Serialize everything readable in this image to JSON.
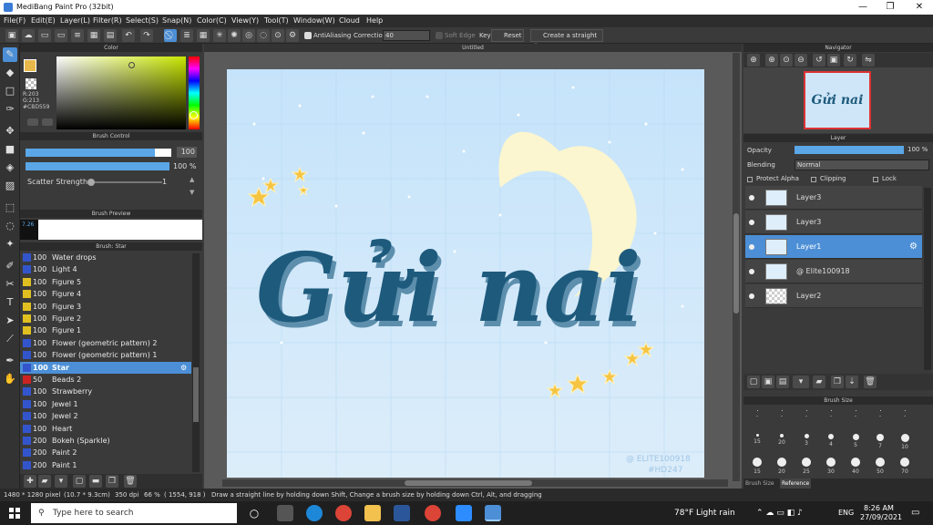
{
  "window": {
    "title": "MediBang Paint Pro (32bit)",
    "minimize": "—",
    "maximize": "❐",
    "close": "✕"
  },
  "menu": [
    "File(F)",
    "Edit(E)",
    "Layer(L)",
    "Filter(R)",
    "Select(S)",
    "Snap(N)",
    "Color(C)",
    "View(Y)",
    "Tool(T)",
    "Window(W)",
    "Cloud",
    "Help"
  ],
  "toolbar": {
    "antialiasing": "AntiAliasing",
    "correction_label": "Correction",
    "correction_value": "40",
    "soft_edge": "Soft Edge",
    "key": "Key",
    "reset": "Reset",
    "straight_line": "Create a straight line"
  },
  "color_panel": {
    "title": "Color",
    "r": "R:203",
    "g": "G:213",
    "hex": "#CBD559",
    "accent": "#CBD559"
  },
  "brush_control": {
    "title": "Brush Control",
    "size_value": "100",
    "opacity_value": "100 %",
    "scatter_label": "Scatter Strength",
    "scatter_value": "1"
  },
  "brush_preview": {
    "title": "Brush Preview",
    "size": "7.26"
  },
  "brush_list": {
    "title": "Brush: Star",
    "items": [
      {
        "size": "100",
        "name": "Water drops",
        "color": "#3355cc"
      },
      {
        "size": "100",
        "name": "Light 4",
        "color": "#3355cc"
      },
      {
        "size": "100",
        "name": "Figure 5",
        "color": "#e0c020"
      },
      {
        "size": "100",
        "name": "Figure 4",
        "color": "#e0c020"
      },
      {
        "size": "100",
        "name": "Figure 3",
        "color": "#e0c020"
      },
      {
        "size": "100",
        "name": "Figure 2",
        "color": "#e0c020"
      },
      {
        "size": "100",
        "name": "Figure 1",
        "color": "#e0c020"
      },
      {
        "size": "100",
        "name": "Flower (geometric pattern) 2",
        "color": "#3355cc"
      },
      {
        "size": "100",
        "name": "Flower (geometric pattern) 1",
        "color": "#3355cc"
      },
      {
        "size": "100",
        "name": "Star",
        "color": "#3355cc"
      },
      {
        "size": "50",
        "name": "Beads 2",
        "color": "#cc2222"
      },
      {
        "size": "100",
        "name": "Strawberry",
        "color": "#3355cc"
      },
      {
        "size": "100",
        "name": "Jewel 1",
        "color": "#3355cc"
      },
      {
        "size": "100",
        "name": "Jewel 2",
        "color": "#3355cc"
      },
      {
        "size": "100",
        "name": "Heart",
        "color": "#3355cc"
      },
      {
        "size": "200",
        "name": "Bokeh (Sparkle)",
        "color": "#3355cc"
      },
      {
        "size": "200",
        "name": "Paint 2",
        "color": "#3355cc"
      },
      {
        "size": "200",
        "name": "Paint 1",
        "color": "#3355cc"
      }
    ]
  },
  "canvas": {
    "tab_title": "Untitled",
    "artwork_text": "Gửi nai",
    "watermark_1": "@ ELITE100918",
    "watermark_2": "#HD247"
  },
  "navigator": {
    "title": "Navigator"
  },
  "layer_panel": {
    "title": "Layer",
    "opacity_label": "Opacity",
    "opacity_value": "100 %",
    "opacity_fraction": 1.0,
    "blending_label": "Blending",
    "blending_value": "Normal",
    "protect_alpha": "Protect Alpha",
    "clipping": "Clipping",
    "lock": "Lock",
    "layers": [
      "Layer3",
      "Layer3",
      "Layer1",
      "@ Elite100918",
      "Layer2"
    ]
  },
  "brush_size": {
    "title": "Brush Size",
    "sizes": [
      "-",
      "-",
      "-",
      "-",
      "-",
      "-",
      "-",
      "15",
      "20",
      "3",
      "4",
      "5",
      "7",
      "10",
      "15",
      "20",
      "25",
      "30",
      "40",
      "50",
      "70"
    ],
    "tabs": [
      "Brush Size",
      "Reference"
    ]
  },
  "status": {
    "dims": "1480 * 1280 pixel",
    "cm": "(10.7 * 9.3cm)",
    "dpi": "350 dpi",
    "zoom": "66 %",
    "coords": "( 1554, 918 )",
    "hint": "Draw a straight line by holding down Shift, Change a brush size by holding down Ctrl, Alt, and dragging"
  },
  "taskbar": {
    "search_placeholder": "Type here to search",
    "weather": "78°F  Light rain",
    "lang": "ENG",
    "time": "8:26 AM",
    "date": "27/09/2021"
  }
}
